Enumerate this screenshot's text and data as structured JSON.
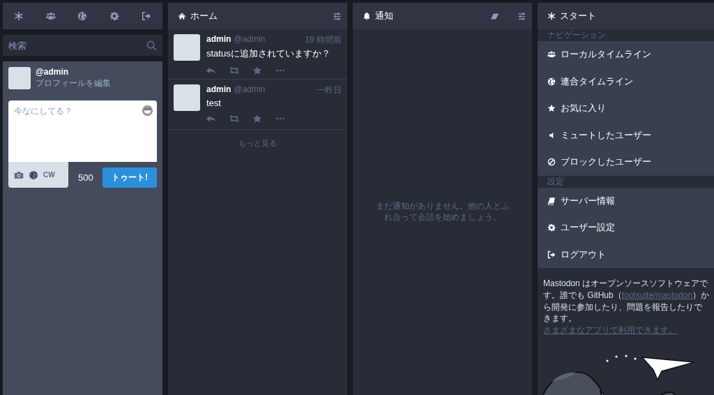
{
  "search": {
    "placeholder": "検索"
  },
  "profile": {
    "handle": "@admin",
    "edit_link": "プロフィールを編集"
  },
  "compose": {
    "placeholder": "今なにしてる？",
    "cw_label": "CW",
    "counter": "500",
    "submit": "トゥート!"
  },
  "home": {
    "title": "ホーム",
    "statuses": [
      {
        "display_name": "admin",
        "acct": "@admin",
        "time": "19 時間前",
        "content": "statusに追加されていますか？"
      },
      {
        "display_name": "admin",
        "acct": "@admin",
        "time": "一昨日",
        "content": "test"
      }
    ],
    "load_more": "もっと見る"
  },
  "notifications": {
    "title": "通知",
    "empty_message": "まだ通知がありません。他の人とふれ合って会話を始めましょう。"
  },
  "getting_started": {
    "title": "スタート",
    "sections": [
      {
        "heading": "ナビゲーション",
        "items": [
          {
            "kind": "people",
            "label": "ローカルタイムライン"
          },
          {
            "kind": "globe",
            "label": "連合タイムライン"
          },
          {
            "kind": "star",
            "label": "お気に入り"
          },
          {
            "kind": "mute",
            "label": "ミュートしたユーザー"
          },
          {
            "kind": "block",
            "label": "ブロックしたユーザー"
          }
        ]
      },
      {
        "heading": "設定",
        "items": [
          {
            "kind": "book",
            "label": "サーバー情報"
          },
          {
            "kind": "gear",
            "label": "ユーザー設定"
          },
          {
            "kind": "logout",
            "label": "ログアウト"
          }
        ]
      }
    ],
    "footer": {
      "before": "Mastodon はオープンソースソフトウェアです。誰でも GitHub（",
      "repo_link": "tootsuite/mastodon",
      "middle": "）から開発に参加したり、問題を報告したりできます。 ",
      "apps_link": "さまざまなアプリで利用できます。"
    }
  }
}
